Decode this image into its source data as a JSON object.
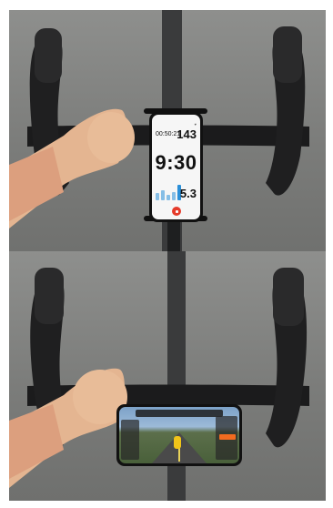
{
  "photos": [
    {
      "name": "portrait-mount-photo",
      "phone_screen": {
        "elapsed_time": "00:50:21",
        "heart_rate": "143",
        "clock": "9:30",
        "speed": "5.3",
        "bar_levels": [
          0.45,
          0.6,
          0.35,
          0.5,
          0.95
        ],
        "accent_color": "#2a8fd8",
        "stop_color": "#e53b2a"
      }
    },
    {
      "name": "landscape-mount-photo",
      "phone_screen": {
        "app": "cycling-game",
        "accent_color": "#f26b1f"
      }
    }
  ]
}
